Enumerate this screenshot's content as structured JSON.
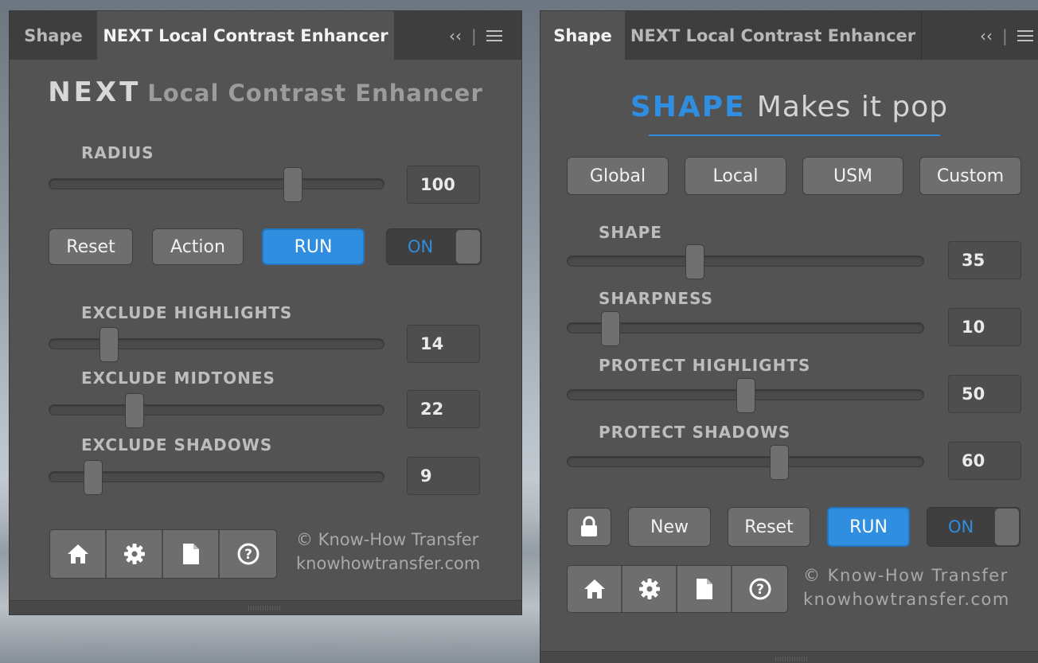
{
  "left_panel": {
    "tabs": [
      {
        "label": "Shape",
        "active": false
      },
      {
        "label": "NEXT Local Contrast Enhancer",
        "active": true
      }
    ],
    "collapse_glyph": "‹‹",
    "divider_glyph": "|",
    "title_strong": "NEXT",
    "title_light": "Local Contrast Enhancer",
    "sliders": [
      {
        "label": "RADIUS",
        "value": "100",
        "fraction": 0.74
      },
      {
        "label": "EXCLUDE HIGHLIGHTS",
        "value": "14",
        "fraction": 0.16
      },
      {
        "label": "EXCLUDE MIDTONES",
        "value": "22",
        "fraction": 0.24
      },
      {
        "label": "EXCLUDE SHADOWS",
        "value": "9",
        "fraction": 0.11
      }
    ],
    "buttons": {
      "reset": "Reset",
      "action": "Action",
      "run": "RUN"
    },
    "toggle": {
      "label": "ON",
      "state": "on"
    },
    "icons": [
      "home-icon",
      "gear-icon",
      "document-icon",
      "help-icon"
    ],
    "credit_line1": "© Know-How Transfer",
    "credit_line2": "knowhowtransfer.com"
  },
  "right_panel": {
    "tabs": [
      {
        "label": "Shape",
        "active": true
      },
      {
        "label": "NEXT Local Contrast Enhancer",
        "active": false
      }
    ],
    "collapse_glyph": "‹‹",
    "divider_glyph": "|",
    "title_strong": "SHAPE",
    "title_light": "Makes it pop",
    "modes": [
      "Global",
      "Local",
      "USM",
      "Custom"
    ],
    "sliders": [
      {
        "label": "SHAPE",
        "value": "35",
        "fraction": 0.35
      },
      {
        "label": "SHARPNESS",
        "value": "10",
        "fraction": 0.1
      },
      {
        "label": "PROTECT HIGHLIGHTS",
        "value": "50",
        "fraction": 0.5
      },
      {
        "label": "PROTECT SHADOWS",
        "value": "60",
        "fraction": 0.6
      }
    ],
    "buttons": {
      "new": "New",
      "reset": "Reset",
      "run": "RUN"
    },
    "toggle": {
      "label": "ON",
      "state": "on"
    },
    "icons": [
      "lock-icon",
      "home-icon",
      "gear-icon",
      "document-icon",
      "help-icon"
    ],
    "credit_line1": "©  Know-How Transfer",
    "credit_line2": "knowhowtransfer.com"
  },
  "colors": {
    "panel_bg": "#535353",
    "tabbar_bg": "#3e3e3e",
    "accent_blue": "#2f8ee0",
    "button_gray": "#6e6e6e"
  }
}
